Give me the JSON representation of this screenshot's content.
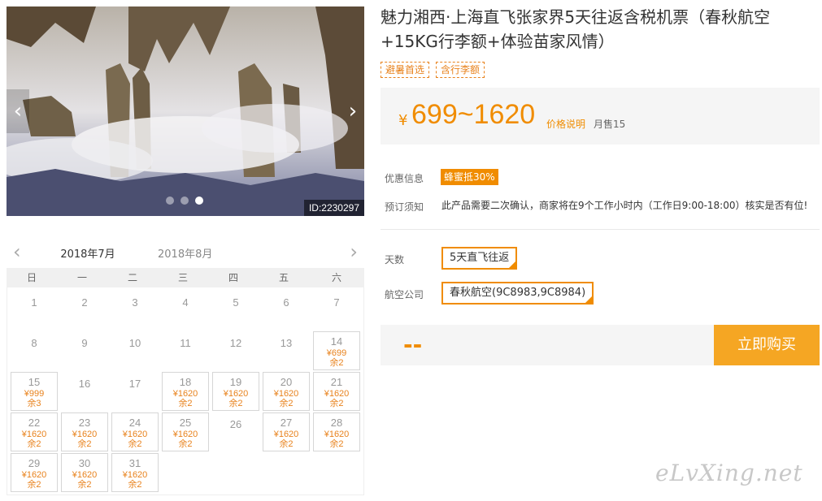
{
  "gallery": {
    "image_id": "ID:2230297",
    "prev_label": "‹",
    "next_label": "›",
    "slide_count": 3,
    "active_slide": 3
  },
  "title": "魅力湘西·上海直飞张家界5天往返含税机票（春秋航空+15KG行李额+体验苗家风情）",
  "tags": [
    "避暑首选",
    "含行李额"
  ],
  "price": {
    "currency": "¥",
    "range": "699~1620",
    "note": "价格说明",
    "sold": "月售15"
  },
  "info": {
    "promo_label": "优惠信息",
    "promo_badge": "蜂蜜抵30%",
    "notice_label": "预订须知",
    "notice_text": "此产品需要二次确认，商家将在9个工作小时内（工作日9:00-18:00）核实是否有位!"
  },
  "options": {
    "days_label": "天数",
    "days_value": "5天直飞往返",
    "airline_label": "航空公司",
    "airline_value": "春秋航空(9C8983,9C8984)"
  },
  "buy": {
    "total": "--",
    "button": "立即购买"
  },
  "calendar": {
    "month_active": "2018年7月",
    "month_next": "2018年8月",
    "weekdays": [
      "日",
      "一",
      "二",
      "三",
      "四",
      "五",
      "六"
    ],
    "days": [
      {
        "d": "1"
      },
      {
        "d": "2"
      },
      {
        "d": "3"
      },
      {
        "d": "4"
      },
      {
        "d": "5"
      },
      {
        "d": "6"
      },
      {
        "d": "7"
      },
      {
        "d": "8"
      },
      {
        "d": "9"
      },
      {
        "d": "10"
      },
      {
        "d": "11"
      },
      {
        "d": "12"
      },
      {
        "d": "13"
      },
      {
        "d": "14",
        "p": "¥699",
        "r": "余2"
      },
      {
        "d": "15",
        "p": "¥999",
        "r": "余3"
      },
      {
        "d": "16"
      },
      {
        "d": "17"
      },
      {
        "d": "18",
        "p": "¥1620",
        "r": "余2"
      },
      {
        "d": "19",
        "p": "¥1620",
        "r": "余2"
      },
      {
        "d": "20",
        "p": "¥1620",
        "r": "余2"
      },
      {
        "d": "21",
        "p": "¥1620",
        "r": "余2"
      },
      {
        "d": "22",
        "p": "¥1620",
        "r": "余2"
      },
      {
        "d": "23",
        "p": "¥1620",
        "r": "余2"
      },
      {
        "d": "24",
        "p": "¥1620",
        "r": "余2"
      },
      {
        "d": "25",
        "p": "¥1620",
        "r": "余2"
      },
      {
        "d": "26"
      },
      {
        "d": "27",
        "p": "¥1620",
        "r": "余2"
      },
      {
        "d": "28",
        "p": "¥1620",
        "r": "余2"
      },
      {
        "d": "29",
        "p": "¥1620",
        "r": "余2"
      },
      {
        "d": "30",
        "p": "¥1620",
        "r": "余2"
      },
      {
        "d": "31",
        "p": "¥1620",
        "r": "余2"
      }
    ]
  },
  "watermark": "eLvXing.net",
  "colors": {
    "accent": "#f08c00",
    "buy_button": "#f5a623",
    "panel_bg": "#f5f5f5"
  }
}
